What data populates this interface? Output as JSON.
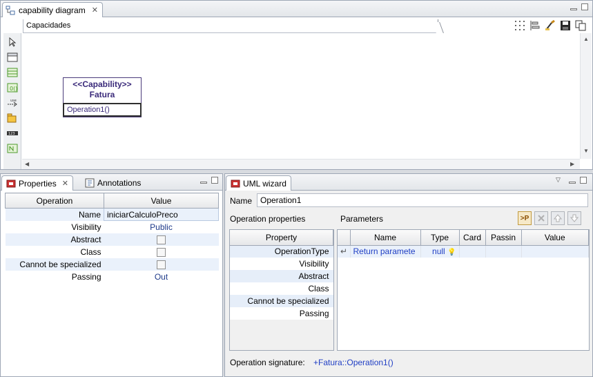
{
  "editor": {
    "tab_label": "capability diagram",
    "diagram_name": "Capacidades"
  },
  "capability": {
    "stereotype": "<<Capability>>",
    "name": "Fatura",
    "operation": "Operation1()"
  },
  "properties_view": {
    "tabs": [
      {
        "label": "Properties"
      },
      {
        "label": "Annotations"
      }
    ],
    "headers": [
      "Operation",
      "Value"
    ],
    "rows": [
      {
        "name": "Name",
        "value": "iniciarCalculoPreco"
      },
      {
        "name": "Visibility",
        "value": "Public"
      },
      {
        "name": "Abstract",
        "value": ""
      },
      {
        "name": "Class",
        "value": ""
      },
      {
        "name": "Cannot be specialized",
        "value": ""
      },
      {
        "name": "Passing",
        "value": "Out"
      }
    ]
  },
  "wizard": {
    "tab_label": "UML wizard",
    "name_label": "Name",
    "name_value": "Operation1",
    "op_props_label": "Operation properties",
    "params_label": "Parameters",
    "op_header": "Property",
    "op_rows": [
      "OperationType",
      "Visibility",
      "Abstract",
      "Class",
      "Cannot be specialized",
      "Passing"
    ],
    "param_headers": [
      "Name",
      "Type",
      "Card",
      "Passin",
      "Value"
    ],
    "param_rows": [
      {
        "name": "Return paramete",
        "type": "null",
        "card": "",
        "passing": "",
        "value": ""
      }
    ],
    "signature_label": "Operation signature:",
    "signature_value": "+Fatura::Operation1()",
    "add_param_label": ">P"
  }
}
